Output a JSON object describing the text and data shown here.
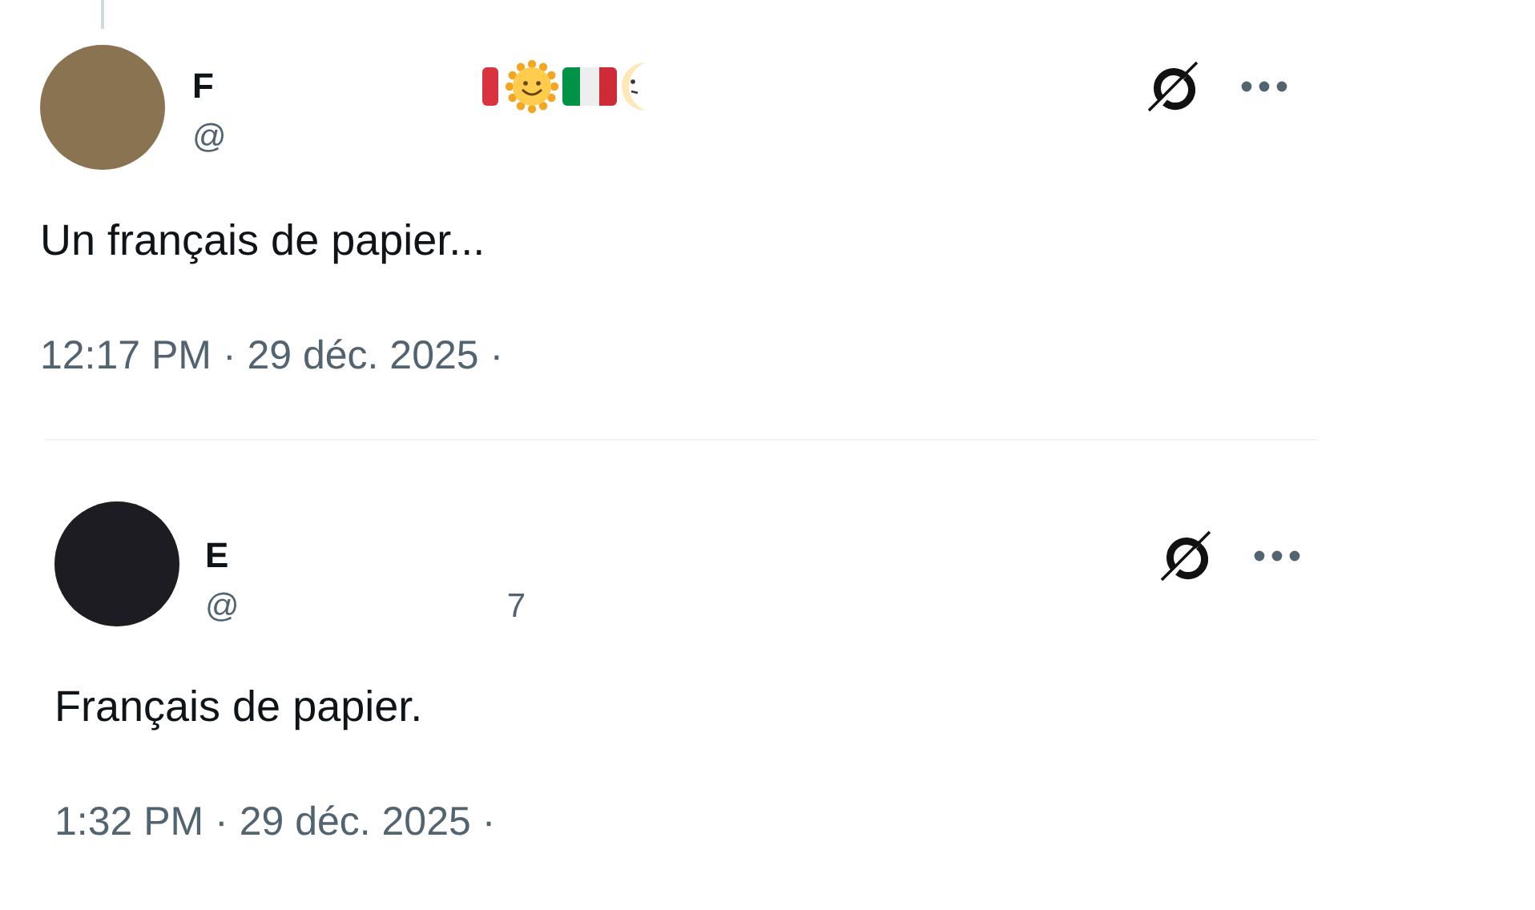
{
  "posts": [
    {
      "name": "F",
      "handle": "@",
      "name_emoji": true,
      "thread_line": true,
      "text": "Un français de papier...",
      "timestamp": "12:17 PM · 29 déc. 2025 ·"
    },
    {
      "name": "E",
      "handle": "@",
      "handle_tail": "7",
      "name_emoji": false,
      "thread_line": false,
      "text": "Français de papier.",
      "timestamp": "1:32 PM · 29 déc. 2025 ·"
    }
  ]
}
